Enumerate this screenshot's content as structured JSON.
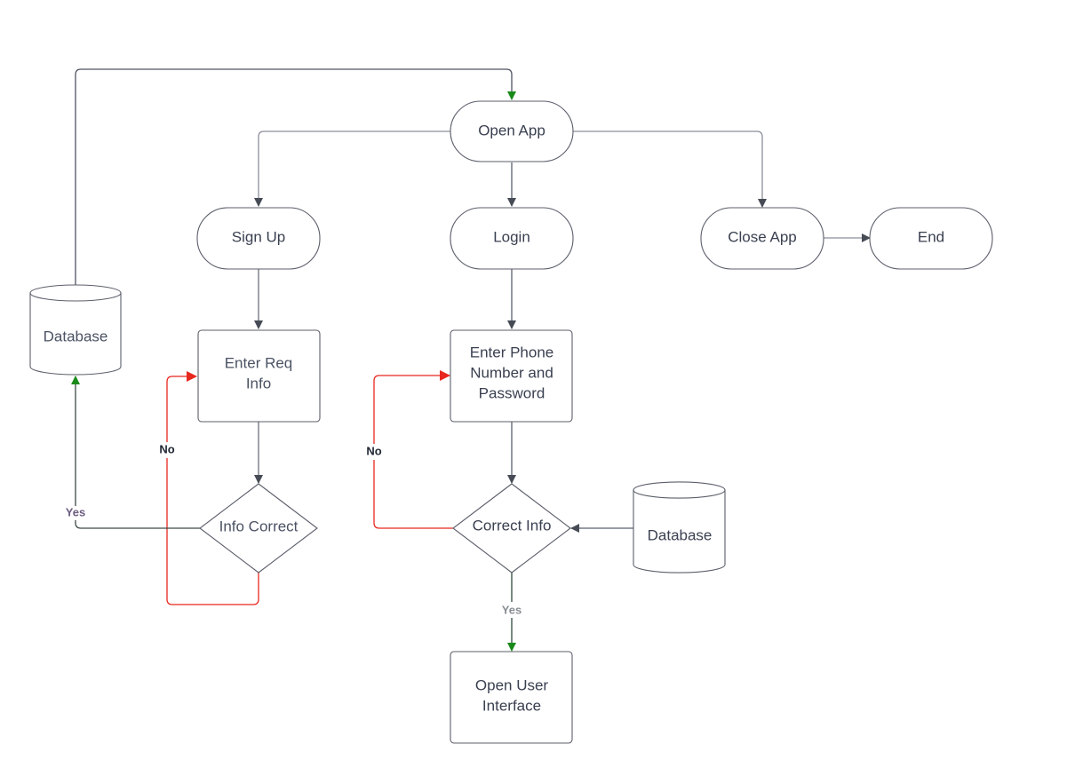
{
  "diagram": {
    "type": "flowchart",
    "colors": {
      "default_edge": "#5b6170",
      "red_edge": "#e8281e",
      "green_arrow": "#1a8a1a",
      "node_stroke": "#5b5f6a",
      "node_text": "#3a4050",
      "yes_label_left": "#6b5c80",
      "yes_label_bottom": "#8a8d94",
      "no_label": "#1f2633"
    },
    "nodes": [
      {
        "id": "open_app",
        "shape": "terminal",
        "lines": [
          "Open App"
        ]
      },
      {
        "id": "sign_up",
        "shape": "terminal",
        "lines": [
          "Sign Up"
        ]
      },
      {
        "id": "login",
        "shape": "terminal",
        "lines": [
          "Login"
        ]
      },
      {
        "id": "close_app",
        "shape": "terminal",
        "lines": [
          "Close App"
        ]
      },
      {
        "id": "end",
        "shape": "terminal",
        "lines": [
          "End"
        ]
      },
      {
        "id": "database_left",
        "shape": "cylinder",
        "lines": [
          "Database"
        ]
      },
      {
        "id": "enter_req_info",
        "shape": "process",
        "lines": [
          "Enter Req",
          "Info"
        ]
      },
      {
        "id": "enter_phone",
        "shape": "process",
        "lines": [
          "Enter Phone",
          "Number and",
          "Password"
        ]
      },
      {
        "id": "info_correct",
        "shape": "decision",
        "lines": [
          "Info Correct"
        ]
      },
      {
        "id": "correct_info",
        "shape": "decision",
        "lines": [
          "Correct Info"
        ]
      },
      {
        "id": "database_right",
        "shape": "cylinder",
        "lines": [
          "Database"
        ]
      },
      {
        "id": "open_user_interface",
        "shape": "process",
        "lines": [
          "Open User",
          "Interface"
        ]
      }
    ],
    "edges": [
      {
        "id": "db_to_open_app",
        "from": "database_left",
        "to": "open_app",
        "color": "default",
        "arrow": "green",
        "label": ""
      },
      {
        "id": "open_app_to_sign_up",
        "from": "open_app",
        "to": "sign_up",
        "color": "default",
        "arrow": "default",
        "label": ""
      },
      {
        "id": "open_app_to_login",
        "from": "open_app",
        "to": "login",
        "color": "default",
        "arrow": "default",
        "label": ""
      },
      {
        "id": "open_app_to_close_app",
        "from": "open_app",
        "to": "close_app",
        "color": "default",
        "arrow": "default",
        "label": ""
      },
      {
        "id": "close_app_to_end",
        "from": "close_app",
        "to": "end",
        "color": "default",
        "arrow": "default",
        "label": ""
      },
      {
        "id": "sign_up_to_enter_req",
        "from": "sign_up",
        "to": "enter_req_info",
        "color": "default",
        "arrow": "default",
        "label": ""
      },
      {
        "id": "enter_req_to_info_correct",
        "from": "enter_req_info",
        "to": "info_correct",
        "color": "default",
        "arrow": "default",
        "label": ""
      },
      {
        "id": "info_correct_yes",
        "from": "info_correct",
        "to": "database_left",
        "color": "default",
        "arrow": "green",
        "label": "Yes"
      },
      {
        "id": "info_correct_no",
        "from": "info_correct",
        "to": "enter_req_info",
        "color": "red",
        "arrow": "red",
        "label": "No"
      },
      {
        "id": "login_to_enter_phone",
        "from": "login",
        "to": "enter_phone",
        "color": "default",
        "arrow": "default",
        "label": ""
      },
      {
        "id": "enter_phone_to_correct_info",
        "from": "enter_phone",
        "to": "correct_info",
        "color": "default",
        "arrow": "default",
        "label": ""
      },
      {
        "id": "correct_info_no",
        "from": "correct_info",
        "to": "enter_phone",
        "color": "red",
        "arrow": "red",
        "label": "No"
      },
      {
        "id": "db_right_to_correct_info",
        "from": "database_right",
        "to": "correct_info",
        "color": "default",
        "arrow": "default",
        "label": ""
      },
      {
        "id": "correct_info_yes",
        "from": "correct_info",
        "to": "open_user_interface",
        "color": "default",
        "arrow": "green",
        "label": "Yes"
      }
    ]
  }
}
